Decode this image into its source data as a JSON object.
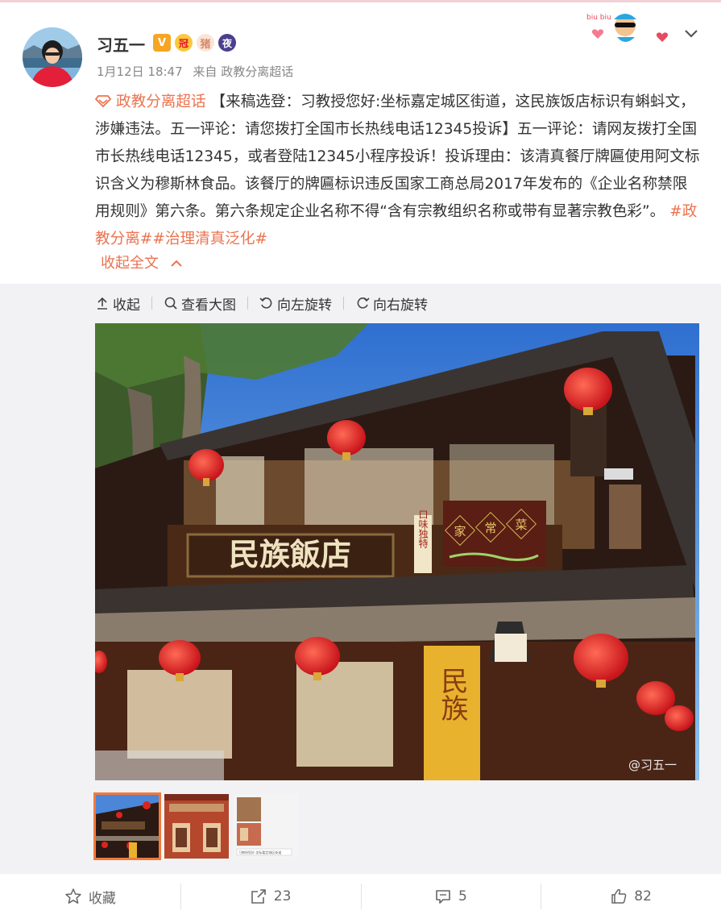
{
  "post": {
    "author": {
      "name": "习五一",
      "badges": [
        "V",
        "冠",
        "猪",
        "夜"
      ]
    },
    "meta": {
      "time": "1月12日 18:47",
      "source": "来自 政教分离超话"
    },
    "content": {
      "topic": "政教分离超话",
      "body": "【来稿选登：习教授您好:坐标嘉定城区街道，这民族饭店标识有蝌蚪文，涉嫌违法。五一评论：请您拨打全国市长热线电话12345投诉】五一评论：请网友拨打全国市长热线电话12345，或者登陆12345小程序投诉！投诉理由：该清真餐厅牌匾使用阿文标识含义为穆斯林食品。该餐厅的牌匾标识违反国家工商总局2017年发布的《企业名称禁限用规则》第六条。第六条规定企业名称不得“含有宗教组织名称或带有显著宗教色彩”。",
      "hashtags": "#政教分离##治理清真泛化#",
      "collapse_label": "收起全文"
    },
    "deco_text": "biu biu",
    "media": {
      "toolbar": {
        "collapse": "收起",
        "view_large": "查看大图",
        "rotate_left": "向左旋转",
        "rotate_right": "向右旋转"
      },
      "sign_text": "民族飯店",
      "side_sign_text": "口味独特",
      "diamond_chars": [
        "家",
        "常",
        "菜"
      ],
      "vertical_sign": "民族",
      "watermark": "@习五一",
      "thumb_caption": "习教授您好 坐标嘉定城区街道"
    },
    "actions": {
      "favorite": "收藏",
      "repost": "23",
      "comment": "5",
      "like": "82"
    }
  }
}
